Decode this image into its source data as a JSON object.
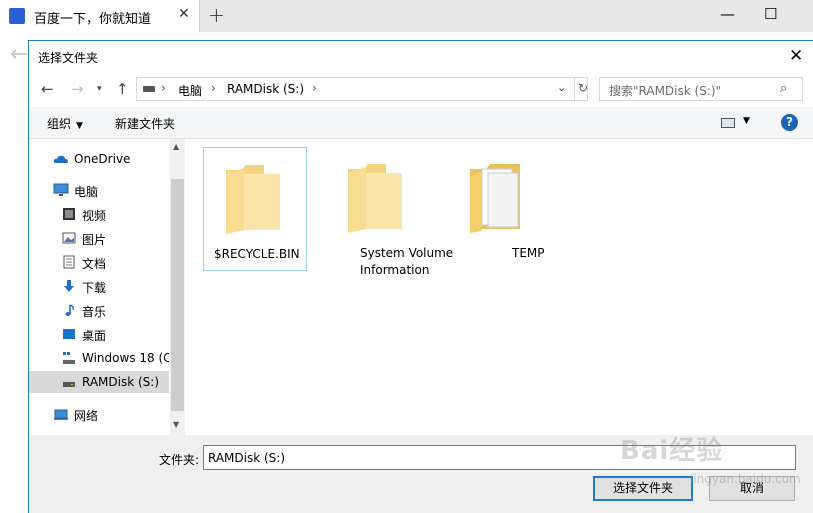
{
  "browser": {
    "tab_title": "百度一下，你就知道",
    "tab_close": "✕",
    "new_tab": "+",
    "minimize": "—",
    "maximize": "☐",
    "back_arrow": "←"
  },
  "dialog": {
    "title": "选择文件夹",
    "close": "✕",
    "address": {
      "segments": [
        "电脑",
        "RAMDisk (S:)"
      ],
      "separator": "›"
    },
    "search_placeholder": "搜索\"RAMDisk (S:)\"",
    "toolbar": {
      "organize": "组织",
      "new_folder": "新建文件夹",
      "help": "?"
    },
    "nav": [
      {
        "label": "OneDrive",
        "icon": "cloud-icon"
      },
      {
        "label": "电脑",
        "icon": "computer-icon"
      },
      {
        "label": "视频",
        "icon": "video-icon"
      },
      {
        "label": "图片",
        "icon": "picture-icon"
      },
      {
        "label": "文档",
        "icon": "document-icon"
      },
      {
        "label": "下载",
        "icon": "download-icon"
      },
      {
        "label": "音乐",
        "icon": "music-icon"
      },
      {
        "label": "桌面",
        "icon": "desktop-icon"
      },
      {
        "label": "Windows 18 (C",
        "icon": "drive-windows-icon"
      },
      {
        "label": "RAMDisk (S:)",
        "icon": "drive-icon",
        "selected": true
      },
      {
        "label": "网络",
        "icon": "network-icon"
      }
    ],
    "files": [
      {
        "name": "$RECYCLE.BIN",
        "selected": true
      },
      {
        "name": "System Volume Information"
      },
      {
        "name": "TEMP"
      }
    ],
    "folder_label": "文件夹:",
    "folder_value": "RAMDisk (S:)",
    "select_button": "选择文件夹",
    "cancel_button": "取消"
  },
  "watermark": {
    "text": "Bai经验",
    "url": "jingyan.baidu.com"
  },
  "colors": {
    "accent": "#1e7ad6",
    "dialog_border": "#1e88b4",
    "folder": "#fbe5a8",
    "selection_border": "#99d1e6",
    "selected_nav": "#d9d9d9"
  }
}
